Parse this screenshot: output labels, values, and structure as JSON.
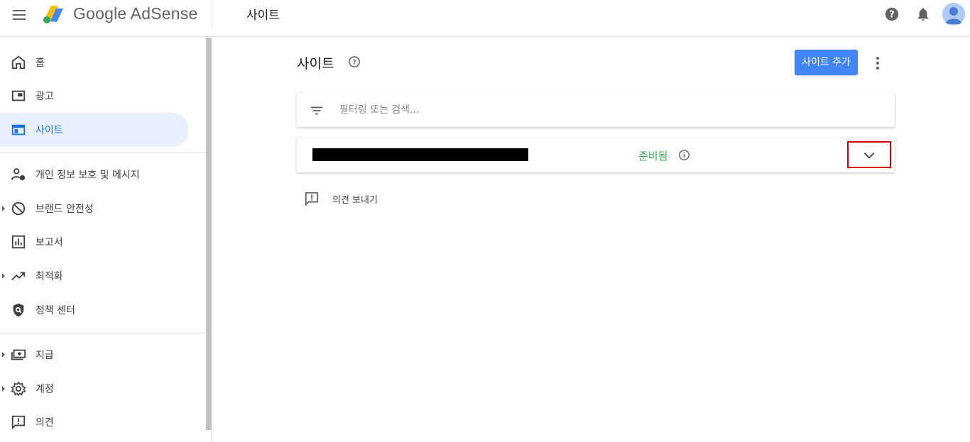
{
  "header": {
    "app_name": "Google AdSense",
    "page_title": "사이트",
    "icons": [
      "menu-icon",
      "adsense-logo",
      "help-icon",
      "notifications-icon",
      "account-avatar"
    ]
  },
  "sidebar": {
    "items": [
      {
        "label": "홈",
        "icon": "home-icon"
      },
      {
        "label": "광고",
        "icon": "ads-icon"
      },
      {
        "label": "사이트",
        "icon": "sites-icon",
        "active": true
      },
      {
        "label": "개인 정보 보호 및 메시지",
        "icon": "privacy-messaging-icon"
      },
      {
        "label": "브랜드 안전성",
        "icon": "block-icon",
        "expandable": true
      },
      {
        "label": "보고서",
        "icon": "reports-icon"
      },
      {
        "label": "최적화",
        "icon": "trending-up-icon",
        "expandable": true
      },
      {
        "label": "정책 센터",
        "icon": "policy-shield-icon"
      },
      {
        "label": "지급",
        "icon": "payments-icon",
        "expandable": true
      },
      {
        "label": "계정",
        "icon": "gear-icon",
        "expandable": true
      },
      {
        "label": "의견",
        "icon": "feedback-icon"
      }
    ]
  },
  "main": {
    "title": "사이트",
    "add_site_label": "사이트 추가",
    "filter_placeholder": "필터링 또는 검색...",
    "sites": [
      {
        "name": "",
        "status": "준비됨"
      }
    ],
    "feedback_label": "의견 보내기"
  },
  "colors": {
    "accent": "#4285f4",
    "active_bg": "#e8f0fe",
    "active_text": "#1a73e8",
    "status_ready": "#34a853",
    "highlight_border": "#d50000"
  }
}
